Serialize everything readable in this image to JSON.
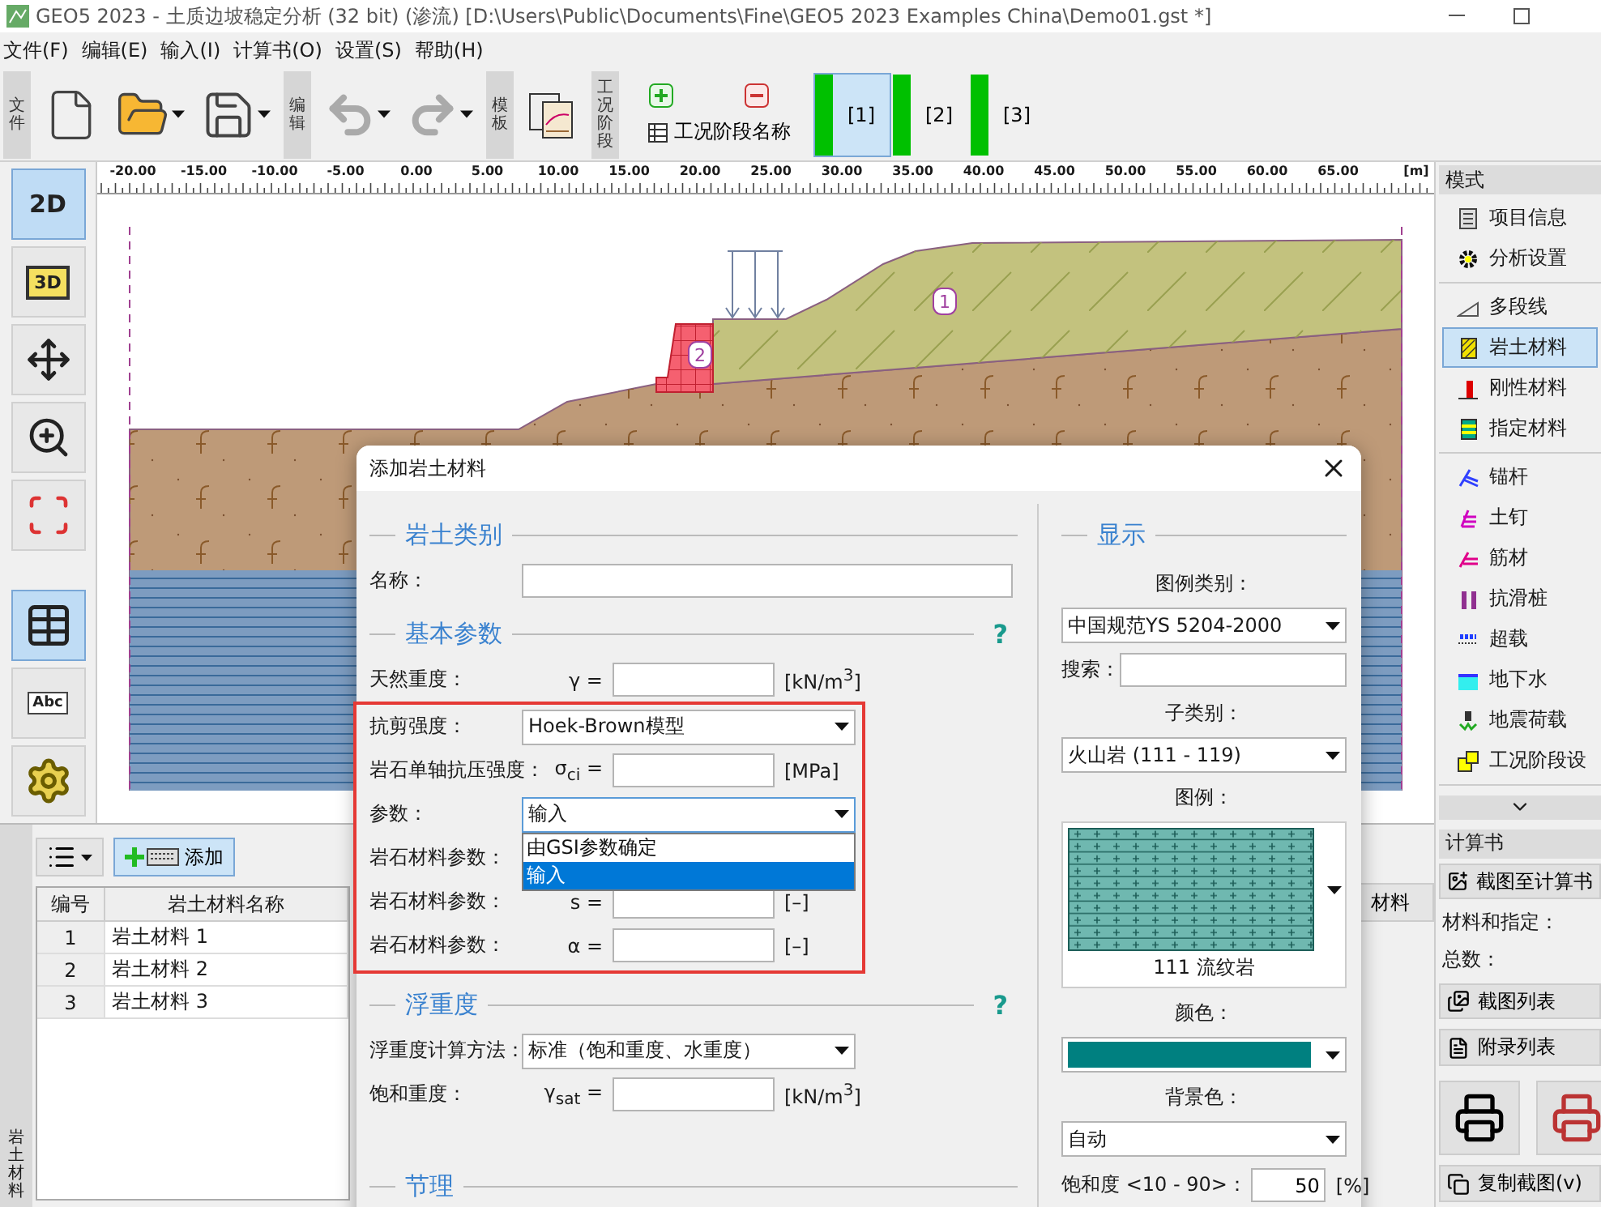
{
  "window": {
    "title": "GEO5 2023 - 土质边坡稳定分析 (32 bit) (渗流) [D:\\Users\\Public\\Documents\\Fine\\GEO5 2023 Examples China\\Demo01.gst *]"
  },
  "menu": [
    "文件(F)",
    "编辑(E)",
    "输入(I)",
    "计算书(O)",
    "设置(S)",
    "帮助(H)"
  ],
  "toolbar": {
    "file_label": "文件",
    "edit_label": "编辑",
    "template_label": "模板",
    "stage_label": "工况阶段",
    "stage_name_button": "工况阶段名称",
    "stages": [
      {
        "label": "[1]",
        "selected": true
      },
      {
        "label": "[2]",
        "selected": false
      },
      {
        "label": "[3]",
        "selected": false
      }
    ]
  },
  "left_tools": [
    {
      "kind": "flat",
      "label": "2D",
      "selected": true
    },
    {
      "kind": "cube",
      "label": "3D",
      "selected": false
    },
    {
      "kind": "move",
      "selected": false
    },
    {
      "kind": "zoom",
      "selected": false
    },
    {
      "kind": "fit",
      "selected": false
    },
    {
      "kind": "table",
      "selected": true
    },
    {
      "kind": "text",
      "label": "Abc",
      "selected": false
    },
    {
      "kind": "settings",
      "selected": false
    }
  ],
  "ruler": {
    "labels": [
      "-20.00",
      "-15.00",
      "-10.00",
      "-5.00",
      "0.00",
      "5.00",
      "10.00",
      "15.00",
      "20.00",
      "25.00",
      "30.00",
      "35.00",
      "40.00",
      "45.00",
      "50.00",
      "55.00",
      "60.00",
      "65.00"
    ],
    "unit": "[m]"
  },
  "canvas": {
    "region_labels": [
      "1",
      "2"
    ]
  },
  "bottom_panel": {
    "tab": "岩土材料",
    "add_button": "添加",
    "side_button": "材料",
    "table": {
      "columns": [
        "编号",
        "岩土材料名称"
      ],
      "rows": [
        [
          "1",
          "岩土材料 1"
        ],
        [
          "2",
          "岩土材料 2"
        ],
        [
          "3",
          "岩土材料 3"
        ]
      ]
    }
  },
  "sidebar": {
    "mode_title": "模式",
    "groups": [
      {
        "items": [
          {
            "kind": "info",
            "label": "项目信息",
            "selected": false
          },
          {
            "kind": "settings",
            "label": "分析设置",
            "selected": false
          }
        ]
      },
      {
        "items": [
          {
            "kind": "polyline",
            "label": "多段线",
            "selected": false
          },
          {
            "kind": "soil",
            "label": "岩土材料",
            "selected": true
          },
          {
            "kind": "rigid",
            "label": "刚性材料",
            "selected": false
          },
          {
            "kind": "assign",
            "label": "指定材料",
            "selected": false
          }
        ]
      },
      {
        "items": [
          {
            "kind": "anchor",
            "label": "锚杆",
            "selected": false
          },
          {
            "kind": "nail",
            "label": "土钉",
            "selected": false
          },
          {
            "kind": "reinforcement",
            "label": "筋材",
            "selected": false
          },
          {
            "kind": "pile",
            "label": "抗滑桩",
            "selected": false
          },
          {
            "kind": "surcharge",
            "label": "超载",
            "selected": false
          },
          {
            "kind": "water",
            "label": "地下水",
            "selected": false
          },
          {
            "kind": "earthquake",
            "label": "地震荷载",
            "selected": false
          },
          {
            "kind": "stage",
            "label": "工况阶段设",
            "selected": false
          }
        ]
      }
    ],
    "report_title": "计算书",
    "report_items": [
      {
        "kind": "capture",
        "label": "截图至计算书"
      },
      {
        "kind": "stat",
        "label": "材料和指定："
      },
      {
        "kind": "stat",
        "label": "总数："
      },
      {
        "kind": "gallery",
        "label": "截图列表"
      },
      {
        "kind": "appendix",
        "label": "附录列表"
      },
      {
        "kind": "print"
      },
      {
        "kind": "copy",
        "label": "复制截图(v)"
      }
    ]
  },
  "dialog": {
    "title": "添加岩土材料",
    "left": [
      {
        "kind": "section",
        "title": "岩土类别"
      },
      {
        "kind": "text",
        "label": "名称："
      },
      {
        "kind": "section",
        "title": "基本参数",
        "help": "?"
      },
      {
        "kind": "number",
        "label": "天然重度：",
        "symbol": "γ =",
        "unit": "[kN/m$^{3}$]"
      },
      {
        "kind": "group",
        "rows": [
          {
            "kind": "select",
            "label": "抗剪强度：",
            "value": "Hoek-Brown模型"
          },
          {
            "kind": "number",
            "label": "岩石单轴抗压强度：",
            "symbol": "σ$_{ci}$ =",
            "unit": "[MPa]"
          },
          {
            "kind": "select",
            "label": "参数：",
            "value": "输入",
            "options": [
              {
                "label": "由GSI参数确定",
                "selected": false
              },
              {
                "label": "输入",
                "selected": true
              }
            ]
          },
          {
            "kind": "covered",
            "label": "岩石材料参数："
          },
          {
            "kind": "number",
            "label": "岩石材料参数：",
            "symbol": "s =",
            "unit": "[–]"
          },
          {
            "kind": "number",
            "label": "岩石材料参数：",
            "symbol": "α =",
            "unit": "[–]"
          }
        ]
      },
      {
        "kind": "section",
        "title": "浮重度",
        "help": "?"
      },
      {
        "kind": "select",
        "label": "浮重度计算方法：",
        "value": "标准（饱和重度、水重度）"
      },
      {
        "kind": "number",
        "label": "饱和重度：",
        "symbol": "γ$_{sat}$ =",
        "unit": "[kN/m$^{3}$]"
      },
      {
        "kind": "section",
        "title": "节理"
      }
    ],
    "right": {
      "title": "显示",
      "rows": [
        {
          "kind": "caption",
          "label": "图例类别："
        },
        {
          "kind": "select",
          "value": "中国规范YS 5204-2000"
        },
        {
          "kind": "search",
          "label": "搜索："
        },
        {
          "kind": "caption",
          "label": "子类别："
        },
        {
          "kind": "select",
          "value": "火山岩 (111 - 119)"
        },
        {
          "kind": "caption",
          "label": "图例："
        },
        {
          "kind": "pattern",
          "caption": "111 流纹岩"
        },
        {
          "kind": "caption",
          "label": "颜色："
        },
        {
          "kind": "color",
          "color": "#008080"
        },
        {
          "kind": "caption",
          "label": "背景色："
        },
        {
          "kind": "select",
          "value": "自动"
        },
        {
          "kind": "percent",
          "label": "饱和度 <10 - 90>：",
          "value": "50",
          "unit": "[%]"
        }
      ]
    }
  }
}
